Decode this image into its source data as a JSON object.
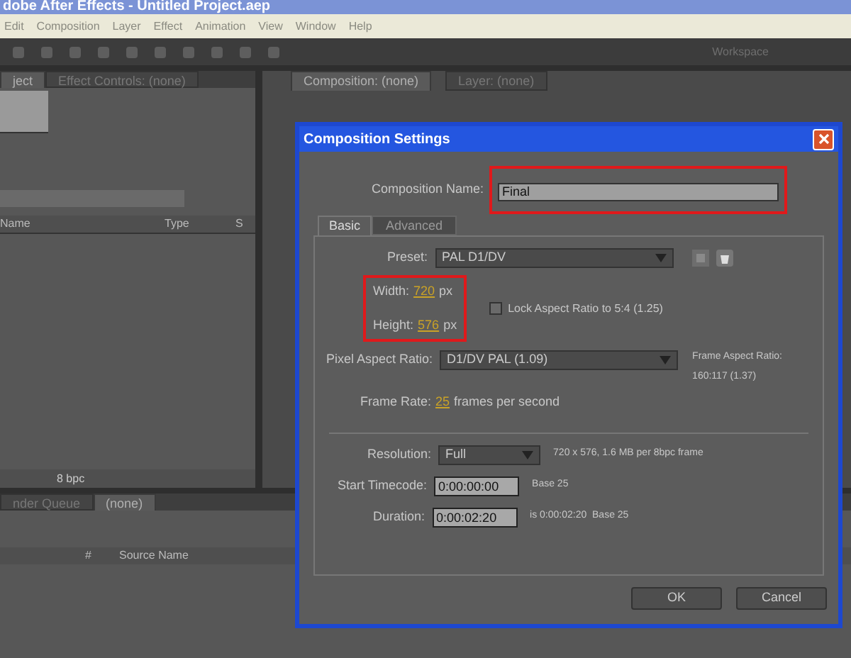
{
  "window": {
    "title": "dobe After Effects - Untitled Project.aep"
  },
  "menu": [
    "Edit",
    "Composition",
    "Layer",
    "Effect",
    "Animation",
    "View",
    "Window",
    "Help"
  ],
  "toolbar": {
    "workspace_label": "Workspace"
  },
  "project_panel": {
    "tabs": [
      {
        "label": "ject",
        "selected": true
      },
      {
        "label": "Effect Controls: (none)",
        "selected": false
      }
    ],
    "columns": [
      "Name",
      "Type",
      "S"
    ],
    "bit_depth": "8 bpc"
  },
  "composition_panel": {
    "tabs": [
      {
        "label": "Composition: (none)",
        "selected": true
      },
      {
        "label": "Layer: (none)",
        "selected": false
      }
    ]
  },
  "timeline_panel": {
    "tabs": [
      {
        "label": "nder Queue",
        "selected": false
      },
      {
        "label": "(none)",
        "selected": true
      }
    ],
    "columns": [
      "#",
      "Source Name"
    ]
  },
  "dialog": {
    "title": "Composition Settings",
    "name_label": "Composition Name:",
    "name_value": "Final",
    "tabs": [
      {
        "label": "Basic",
        "selected": true
      },
      {
        "label": "Advanced",
        "selected": false
      }
    ],
    "preset_label": "Preset:",
    "preset_value": "PAL D1/DV",
    "width_label": "Width:",
    "width_value": "720",
    "width_unit": "px",
    "height_label": "Height:",
    "height_value": "576",
    "height_unit": "px",
    "lock_aspect": {
      "label": "Lock Aspect Ratio to 5:4 (1.25)",
      "checked": false
    },
    "par_label": "Pixel Aspect Ratio:",
    "par_value": "D1/DV PAL (1.09)",
    "far_label": "Frame Aspect Ratio:",
    "far_value": "160:117 (1.37)",
    "frame_rate_label": "Frame Rate:",
    "frame_rate_value": "25",
    "frame_rate_unit": "frames per second",
    "resolution_label": "Resolution:",
    "resolution_value": "Full",
    "resolution_info": "720 x 576, 1.6 MB per 8bpc frame",
    "start_label": "Start Timecode:",
    "start_value": "0:00:00:00",
    "start_info": "Base 25",
    "duration_label": "Duration:",
    "duration_value": "0:00:02:20",
    "duration_info": "is 0:00:02:20  Base 25",
    "buttons": [
      "OK",
      "Cancel"
    ]
  }
}
